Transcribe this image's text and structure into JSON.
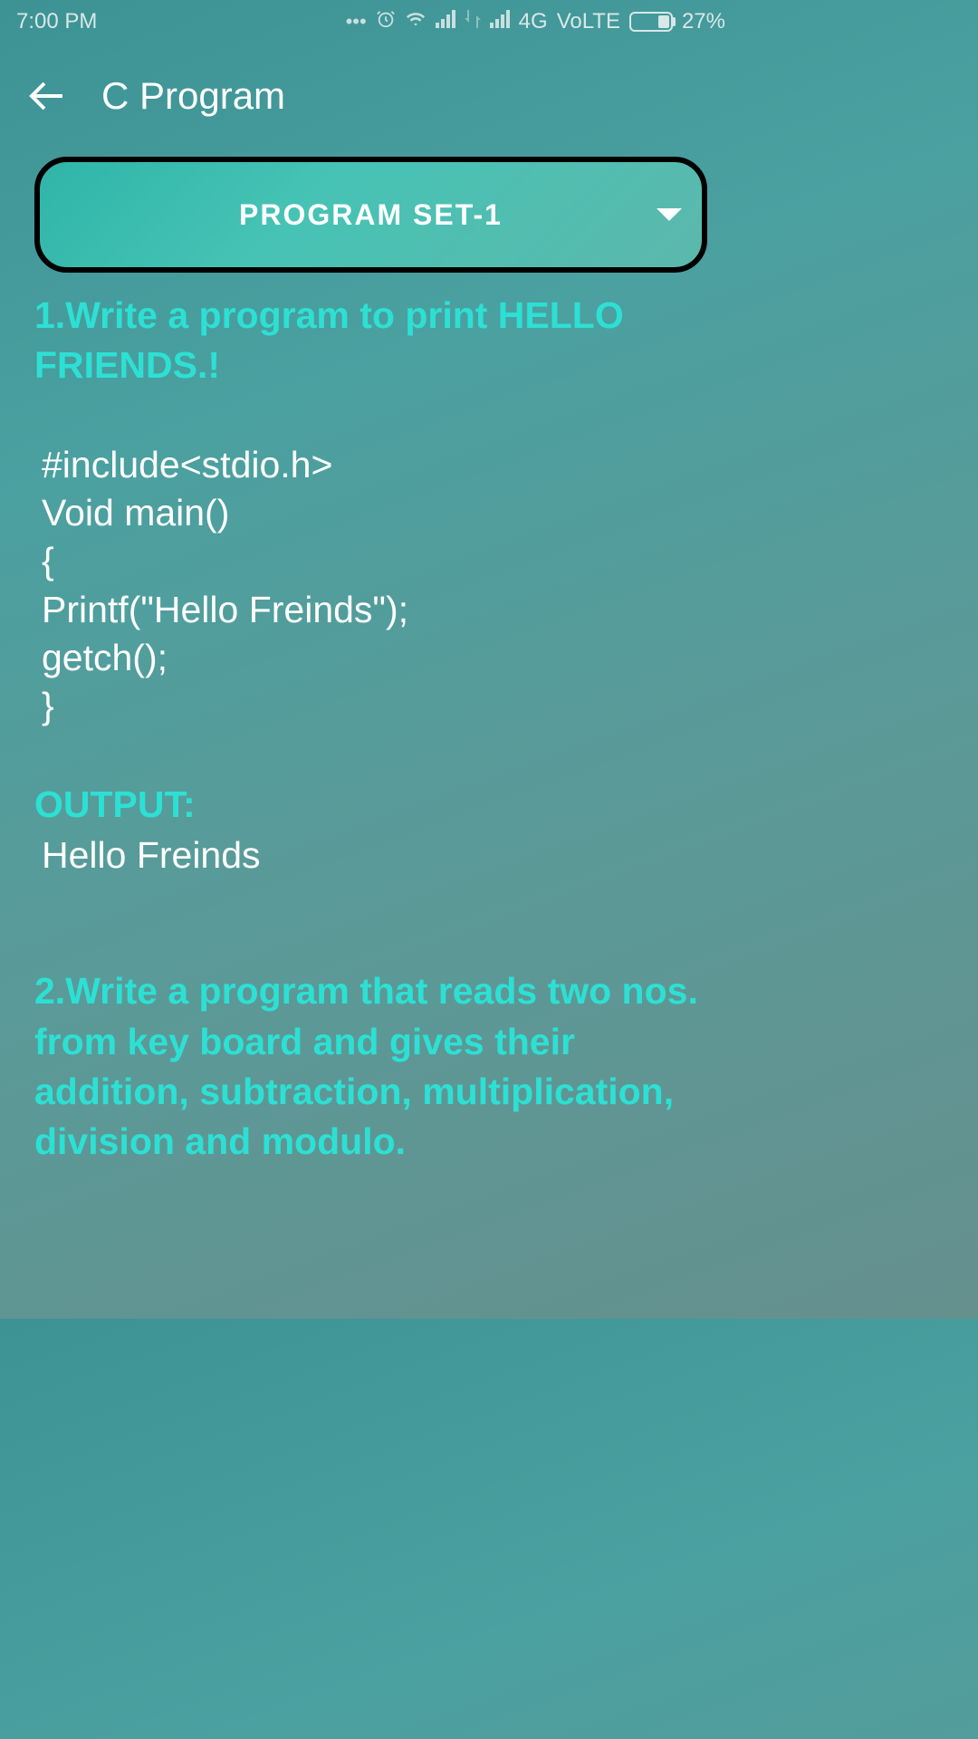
{
  "status_bar": {
    "time": "7:00 PM",
    "network_label": "4G",
    "volte_label": "VoLTE",
    "battery_percent": "27%"
  },
  "header": {
    "title": "C Program"
  },
  "dropdown": {
    "selected_label": "PROGRAM SET-1"
  },
  "questions": [
    {
      "heading": "1.Write a program to print HELLO FRIENDS.!",
      "code": "#include<stdio.h>\nVoid main()\n{\nPrintf(\"Hello Freinds\");\ngetch();\n}",
      "output_label": "OUTPUT:",
      "output_text": "Hello Freinds"
    },
    {
      "heading": "2.Write a program that reads two nos. from key board and gives their addition, subtraction, multiplication, division and modulo."
    }
  ]
}
